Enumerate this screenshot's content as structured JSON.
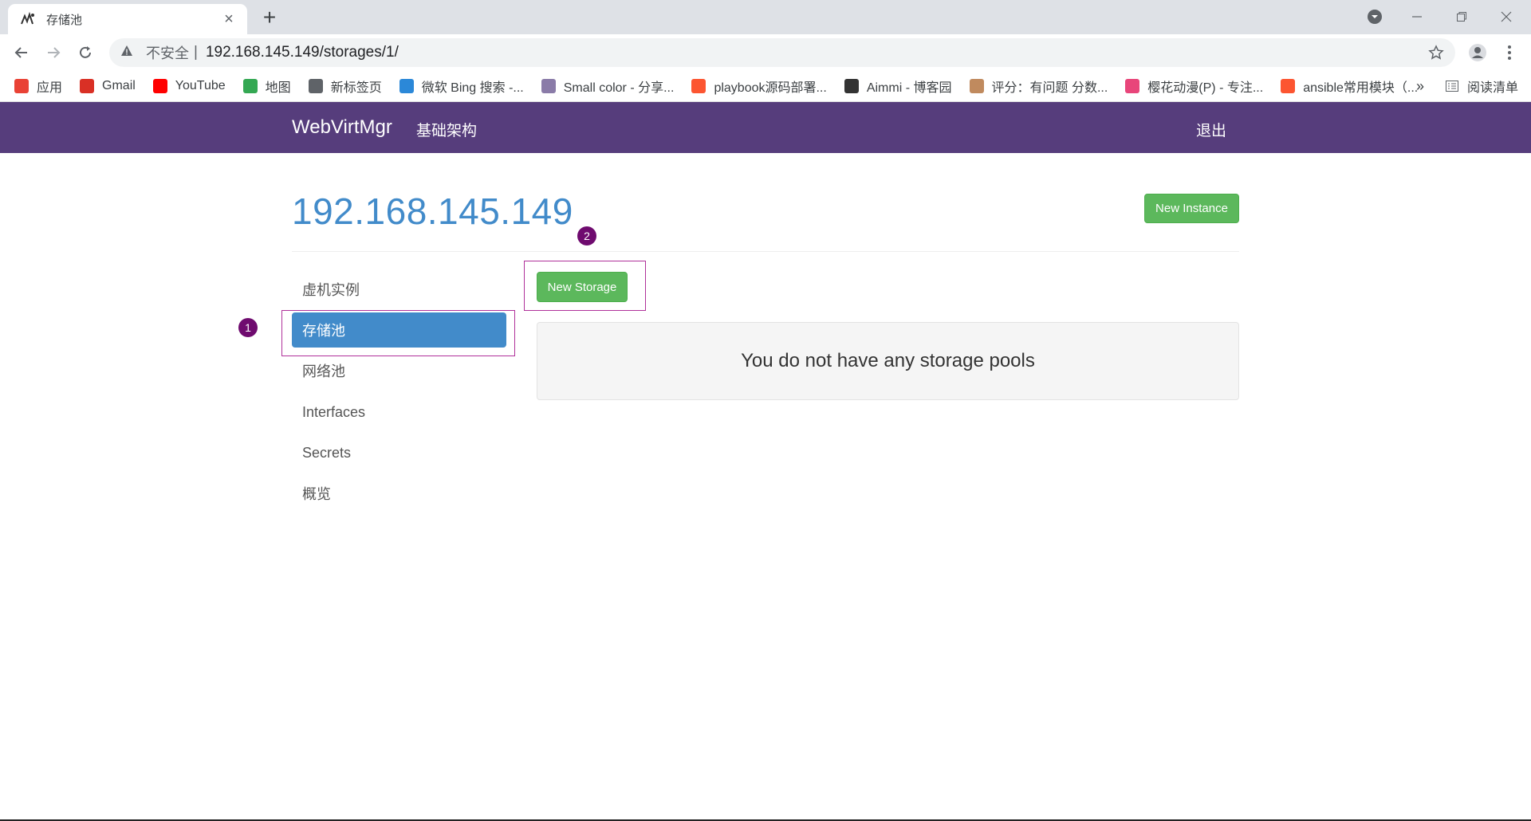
{
  "browser": {
    "tab_title": "存储池",
    "tab_close": "×",
    "new_tab": "+",
    "omnibox": {
      "security_label": "不安全",
      "separator": "|",
      "url": "192.168.145.149/storages/1/"
    },
    "bookmarks": [
      {
        "label": "应用",
        "icon": "apps-grid-icon",
        "color": "#e94235"
      },
      {
        "label": "Gmail",
        "icon": "gmail-icon",
        "color": "#d93025"
      },
      {
        "label": "YouTube",
        "icon": "youtube-icon",
        "color": "#ff0000"
      },
      {
        "label": "地图",
        "icon": "maps-icon",
        "color": "#34a853"
      },
      {
        "label": "新标签页",
        "icon": "globe-icon",
        "color": "#5f6368"
      },
      {
        "label": "微软 Bing 搜索 -...",
        "icon": "bing-icon",
        "color": "#2b88d8"
      },
      {
        "label": "Small color - 分享...",
        "icon": "smallcolor-icon",
        "color": "#8a7ba8"
      },
      {
        "label": "playbook源码部署...",
        "icon": "csdn-icon",
        "color": "#fc5531"
      },
      {
        "label": "Aimmi - 博客园",
        "icon": "cnblogs-icon",
        "color": "#333333"
      },
      {
        "label": "评分：有问题 分数...",
        "icon": "avatar-icon",
        "color": "#c08a5e"
      },
      {
        "label": "樱花动漫(P) - 专注...",
        "icon": "sakura-icon",
        "color": "#e8457a"
      },
      {
        "label": "ansible常用模块（...",
        "icon": "csdn-icon",
        "color": "#fc5531"
      }
    ],
    "bookmarks_overflow": "»",
    "reading_list": "阅读清单"
  },
  "navbar": {
    "brand": "WebVirtMgr",
    "infrastructure": "基础架构",
    "logout": "退出",
    "color": "#563d7c"
  },
  "page": {
    "title": "192.168.145.149",
    "new_instance_label": "New Instance",
    "new_storage_label": "New Storage",
    "empty_message": "You do not have any storage pools"
  },
  "sidebar": {
    "items": [
      {
        "label": "虚机实例",
        "active": false
      },
      {
        "label": "存储池",
        "active": true
      },
      {
        "label": "网络池",
        "active": false
      },
      {
        "label": "Interfaces",
        "active": false
      },
      {
        "label": "Secrets",
        "active": false
      },
      {
        "label": "概览",
        "active": false
      }
    ]
  },
  "annotations": {
    "badge_1": "1",
    "badge_2": "2",
    "color": "#b0319a"
  }
}
